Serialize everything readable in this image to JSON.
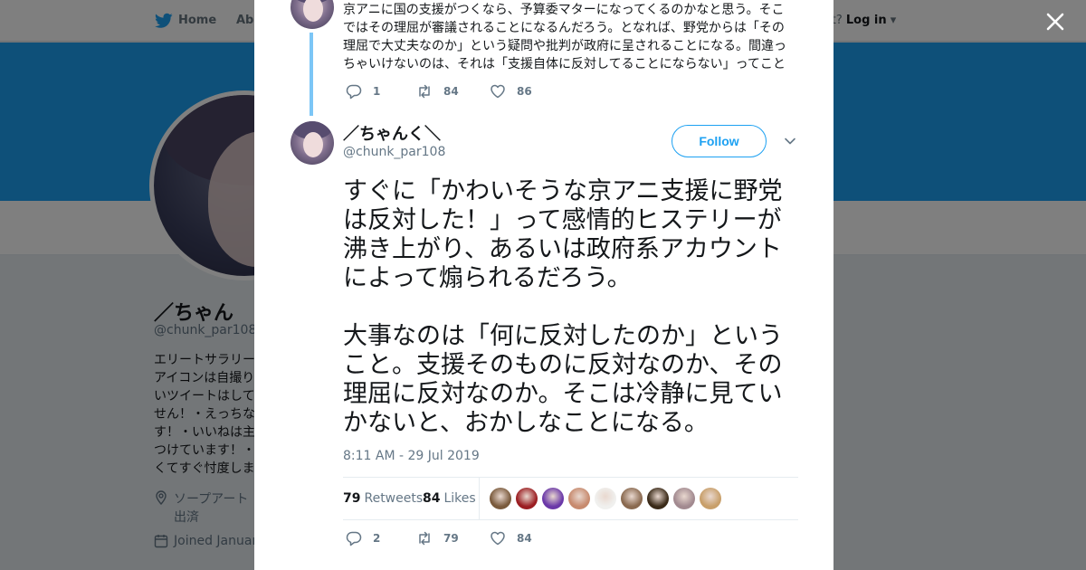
{
  "nav": {
    "home": "Home",
    "about": "Abo",
    "account": "ccount?",
    "login": "Log in"
  },
  "profile": {
    "name": "／ちゃん",
    "handle": "@chunk_par108",
    "bio": "エリートサラリー\nアイコンは自撮り\nいツイートはして\nせん！・えっちな\nす！・いいねは主\nつけています！・\nくてすぐ忖度しま",
    "location": "ソープアート\n出済",
    "joined": "Joined Januar"
  },
  "parent_tweet": {
    "text": "京アニに国の支援がつくなら、予算委マターになってくるのかなと思う。そこではその理屈が審議されることになるんだろう。となれば、野党からは「その理屈で大丈夫なのか」という疑問や批判が政府に呈されることになる。間違っちゃいけないのは、それは「支援自体に反対してることにならない」ってこと",
    "replies": "1",
    "retweets": "84",
    "likes": "86"
  },
  "tweet": {
    "author_name": "／ちゃんく＼",
    "author_handle": "@chunk_par108",
    "follow_label": "Follow",
    "paragraph1": "すぐに「かわいそうな京アニ支援に野党は反対した！」って感情的ヒステリーが沸き上がり、あるいは政府系アカウントによって煽られるだろう。",
    "paragraph2": "大事なのは「何に反対したのか」ということ。支援そのものに反対なのか、その理屈に反対なのか。そこは冷静に見ていかないと、おかしなことになる。",
    "timestamp": "8:11 AM - 29 Jul 2019",
    "retweet_count": "79",
    "retweets_label": "Retweets",
    "like_count": "84",
    "likes_label": "Likes",
    "replies": "2",
    "retweets": "79",
    "likes": "84"
  },
  "likers": [
    "#7a5a3c",
    "#9b1e22",
    "#6a38a8",
    "#c78a6e",
    "#f0f0ee",
    "#8a6a50",
    "#3a2a18",
    "#a28a90",
    "#c89f6a"
  ],
  "colors": {
    "accent": "#1da1f2",
    "thread_line": "#7cc6f6",
    "muted": "#657786"
  },
  "icons": {
    "close": "close-icon",
    "reply": "reply-icon",
    "retweet": "retweet-icon",
    "like": "heart-icon",
    "caret": "chevron-down-icon"
  }
}
